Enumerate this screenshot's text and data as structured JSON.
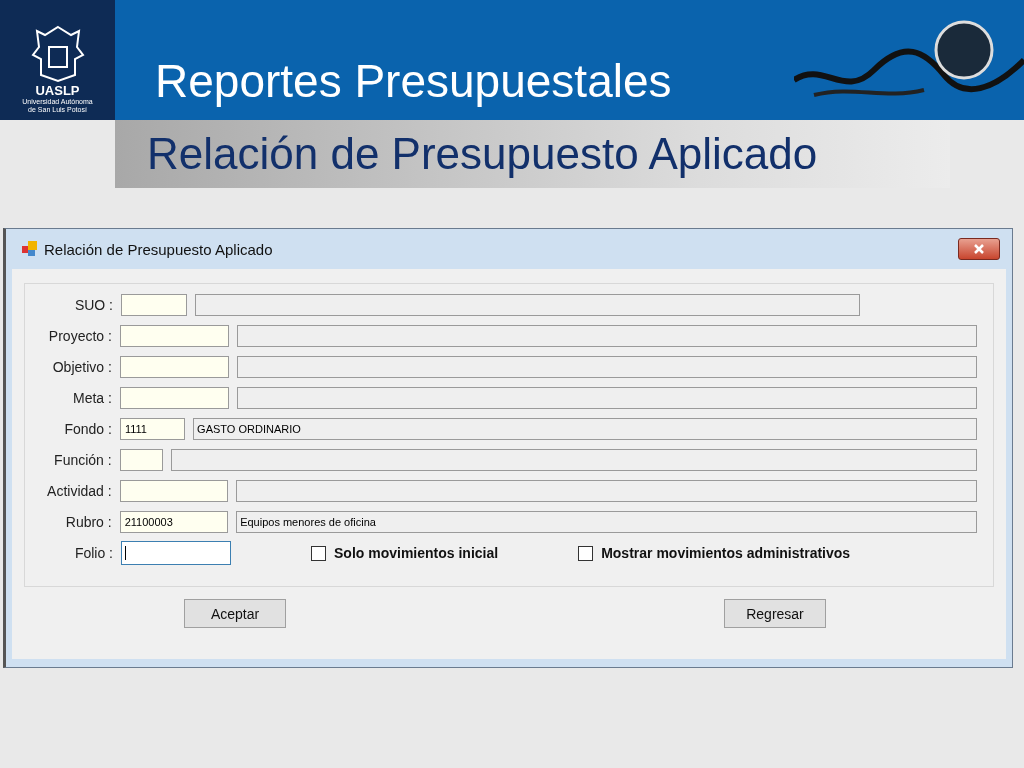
{
  "slide": {
    "logo": {
      "acronym": "UASLP",
      "name_line_1": "Universidad Autónoma",
      "name_line_2": "de San Luis Potosí"
    },
    "title": "Reportes Presupuestales",
    "subtitle": "Relación de Presupuesto Aplicado"
  },
  "window": {
    "title": "Relación de Presupuesto Aplicado",
    "fields": [
      {
        "label": "SUO :",
        "kind": "lookup"
      },
      {
        "label": "Proyecto :",
        "kind": "lookup"
      },
      {
        "label": "Objetivo :",
        "kind": "lookup"
      },
      {
        "label": "Meta :",
        "kind": "lookup"
      },
      {
        "label": "Fondo :",
        "kind": "lookup",
        "code": "1111",
        "description": "GASTO ORDINARIO"
      },
      {
        "label": "Función :",
        "kind": "lookup"
      },
      {
        "label": "Actividad :",
        "kind": "lookup"
      },
      {
        "label": "Rubro :",
        "kind": "lookup",
        "code": "21100003",
        "description": "Equipos menores de oficina"
      },
      {
        "label": "Folio :",
        "kind": "input",
        "focused": true
      }
    ],
    "checkboxes": [
      {
        "label": "Solo movimientos inicial",
        "checked": false
      },
      {
        "label": "Mostrar movimientos administrativos",
        "checked": false
      }
    ],
    "buttons": [
      "Aceptar",
      "Regresar"
    ]
  }
}
